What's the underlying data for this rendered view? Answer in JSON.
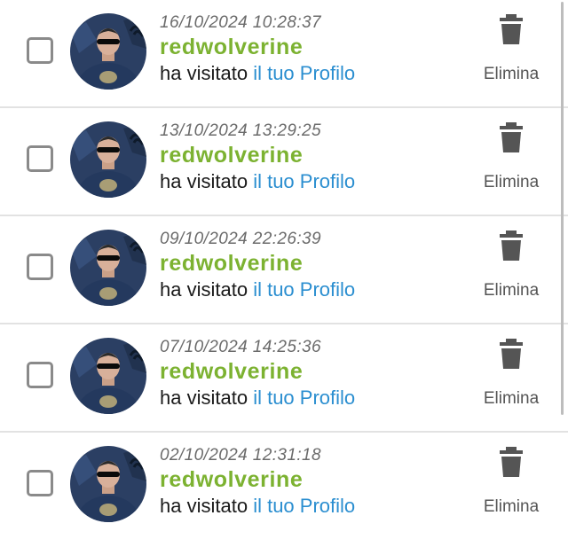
{
  "visits": [
    {
      "date": "16/10/2024 10:28:37",
      "username": "redwolverine",
      "action_prefix": "ha visitato",
      "action_link": "il tuo Profilo",
      "delete_label": "Elimina"
    },
    {
      "date": "13/10/2024 13:29:25",
      "username": "redwolverine",
      "action_prefix": "ha visitato",
      "action_link": "il tuo Profilo",
      "delete_label": "Elimina"
    },
    {
      "date": "09/10/2024 22:26:39",
      "username": "redwolverine",
      "action_prefix": "ha visitato",
      "action_link": "il tuo Profilo",
      "delete_label": "Elimina"
    },
    {
      "date": "07/10/2024 14:25:36",
      "username": "redwolverine",
      "action_prefix": "ha visitato",
      "action_link": "il tuo Profilo",
      "delete_label": "Elimina"
    },
    {
      "date": "02/10/2024 12:31:18",
      "username": "redwolverine",
      "action_prefix": "ha visitato",
      "action_link": "il tuo Profilo",
      "delete_label": "Elimina"
    }
  ],
  "colors": {
    "username": "#7cb231",
    "link": "#2a8ed0",
    "date": "#6b6b6b",
    "trash": "#555555",
    "checkbox_border": "#8a8a8a"
  },
  "icons": {
    "delete": "trash-icon",
    "avatar": "user-avatar"
  }
}
